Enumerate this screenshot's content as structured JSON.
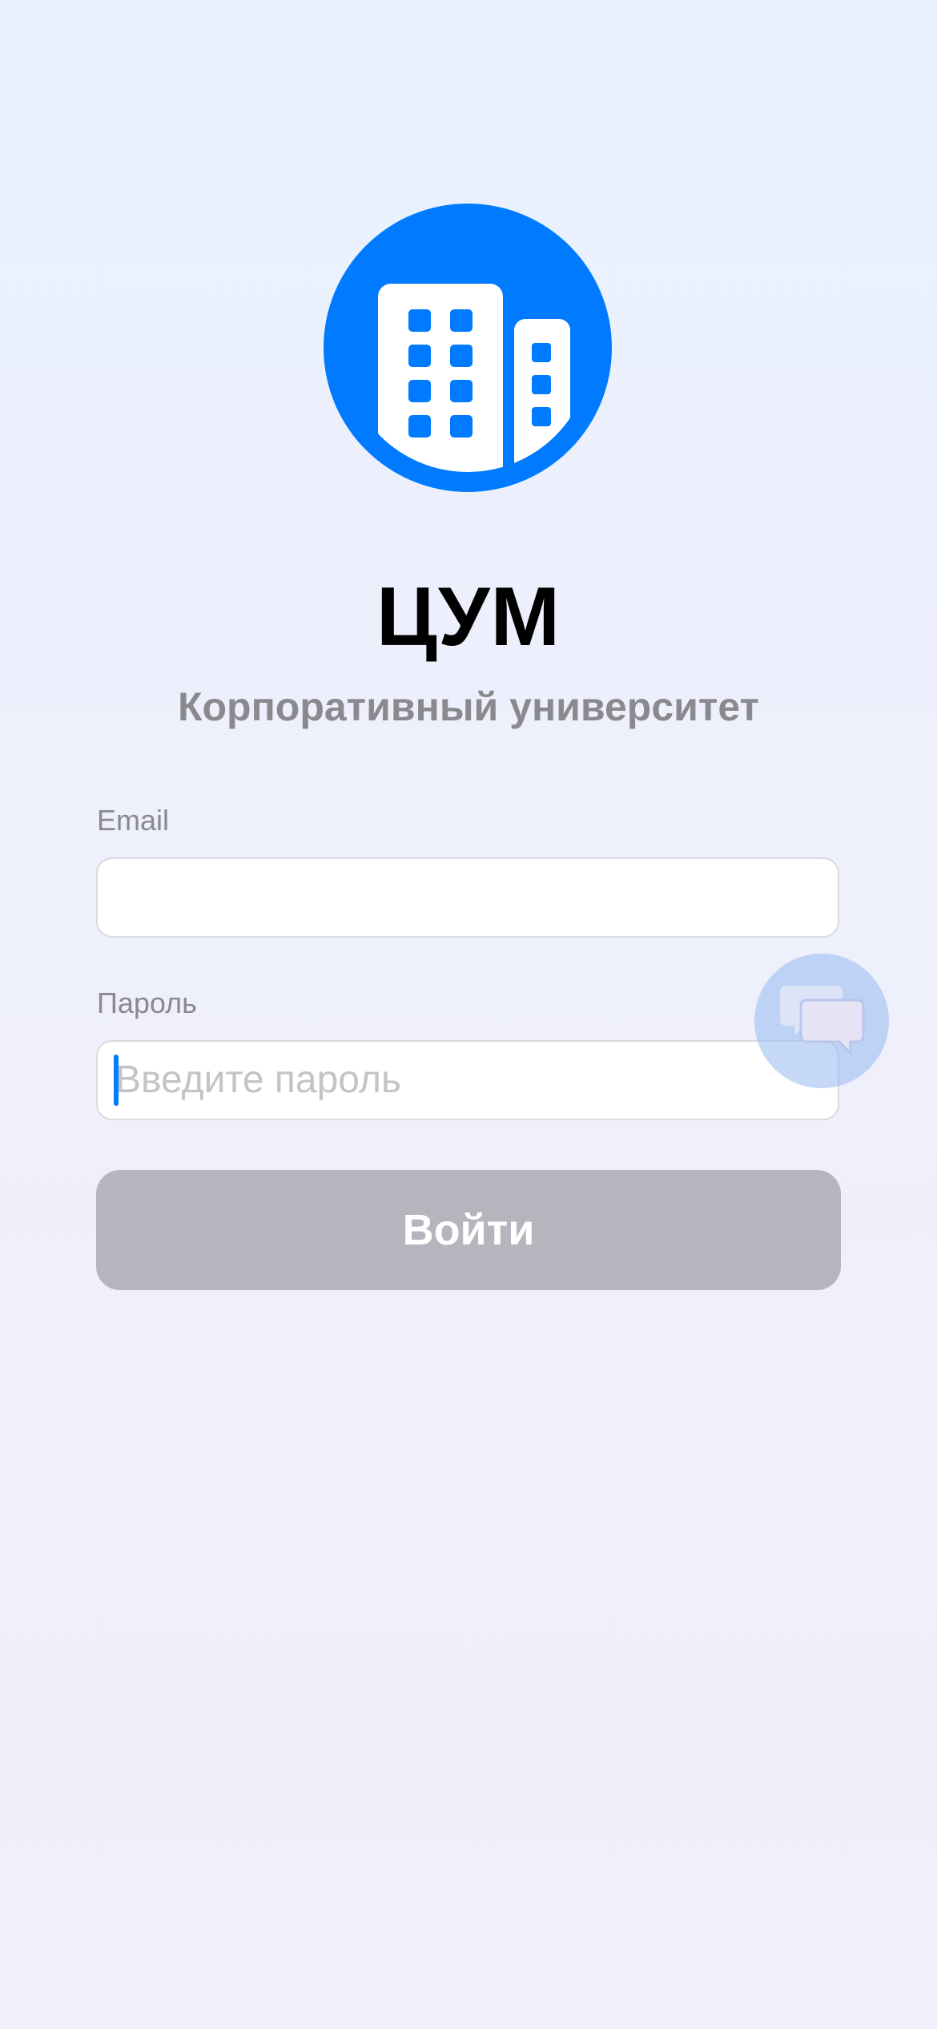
{
  "app": {
    "title": "ЦУМ",
    "subtitle": "Корпоративный университет"
  },
  "form": {
    "email": {
      "label": "Email",
      "value": "",
      "placeholder": ""
    },
    "password": {
      "label": "Пароль",
      "value": "",
      "placeholder": "Введите пароль"
    },
    "submit_label": "Войти"
  },
  "icons": {
    "logo": "building-icon",
    "chat": "chat-bubbles-icon"
  },
  "colors": {
    "accent": "#007aff",
    "button_disabled": "#b6b5bd",
    "label_gray": "#8a8a8e"
  }
}
